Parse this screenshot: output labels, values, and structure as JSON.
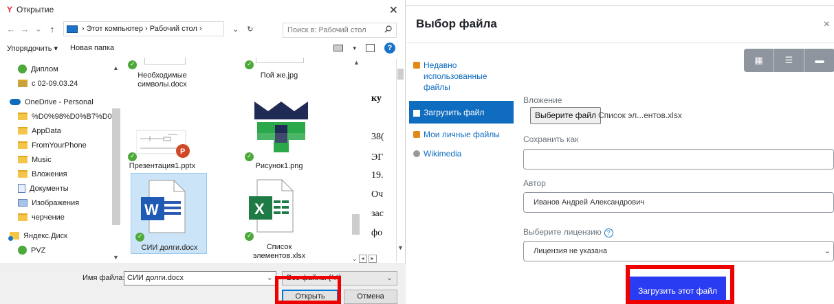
{
  "open_dialog": {
    "title": "Открытие",
    "close_glyph": "✕",
    "nav": {
      "back": "←",
      "forward": "→",
      "recent": "⌄",
      "up": "↑",
      "path": "› Этот компьютер › Рабочий стол ›",
      "dropdown": "⌄",
      "refresh": "↻"
    },
    "search_placeholder": "Поиск в: Рабочий стол",
    "organize_label": "Упорядочить ▾",
    "new_folder_label": "Новая папка",
    "help_glyph": "?",
    "nav_pane": [
      {
        "label": "Диплом",
        "icon": "green-folder-icon"
      },
      {
        "label": "с 02-09.03.24",
        "icon": "shared-folder-icon"
      },
      {
        "label": "OneDrive - Personal",
        "icon": "onedrive-icon"
      },
      {
        "label": "%D0%98%D0%B7%D0%",
        "icon": "folder-icon"
      },
      {
        "label": "AppData",
        "icon": "folder-icon"
      },
      {
        "label": "FromYourPhone",
        "icon": "folder-icon"
      },
      {
        "label": "Music",
        "icon": "folder-icon"
      },
      {
        "label": "Вложения",
        "icon": "folder-icon"
      },
      {
        "label": "Документы",
        "icon": "documents-icon"
      },
      {
        "label": "Изображения",
        "icon": "pictures-icon"
      },
      {
        "label": "черчение",
        "icon": "folder-icon"
      },
      {
        "label": "Яндекс.Диск",
        "icon": "yandex-disk-icon"
      },
      {
        "label": "PVZ",
        "icon": "green-folder-icon"
      }
    ],
    "files": [
      {
        "name": "Необходимые символы.docx"
      },
      {
        "name": "Пой же.jpg"
      },
      {
        "name": "Презентация1.pptx"
      },
      {
        "name": "Рисунок1.png"
      },
      {
        "name": "СИИ долги.docx"
      },
      {
        "name": "Список элементов.xlsx"
      }
    ],
    "preview_lines": [
      "ку",
      "38(",
      "ЭГ",
      "19.",
      "Оч",
      "зас",
      "фо"
    ],
    "filename_label": "Имя файла:",
    "filename_value": "СИИ долги.docx",
    "filter_value": "Все файлы (*.*)",
    "open_button": "Открыть",
    "cancel_button": "Отмена"
  },
  "file_picker": {
    "title": "Выбор файла",
    "close_glyph": "×",
    "repositories": [
      {
        "label": "Недавно использованные файлы",
        "icon": "recent-files-icon"
      },
      {
        "label": "Загрузить файл",
        "icon": "upload-icon"
      },
      {
        "label": "Мои личные файлы",
        "icon": "private-files-icon"
      },
      {
        "label": "Wikimedia",
        "icon": "wikimedia-icon"
      }
    ],
    "view_buttons": [
      "▦",
      "☰",
      "▬"
    ],
    "attachment_label": "Вложение",
    "choose_file_button": "Выберите файл",
    "chosen_file": "Список эл...ентов.xlsx",
    "save_as_label": "Сохранить как",
    "save_as_value": "",
    "author_label": "Автор",
    "author_value": "Иванов Андрей Александрович",
    "license_label": "Выберите лицензию",
    "license_value": "Лицензия не указана",
    "upload_button": "Загрузить этот файл"
  },
  "colors": {
    "highlight": "#ee0000",
    "moodle_blue": "#0f6cbf",
    "upload_button": "#2a3cf2",
    "windows_accent": "#0078d7"
  }
}
